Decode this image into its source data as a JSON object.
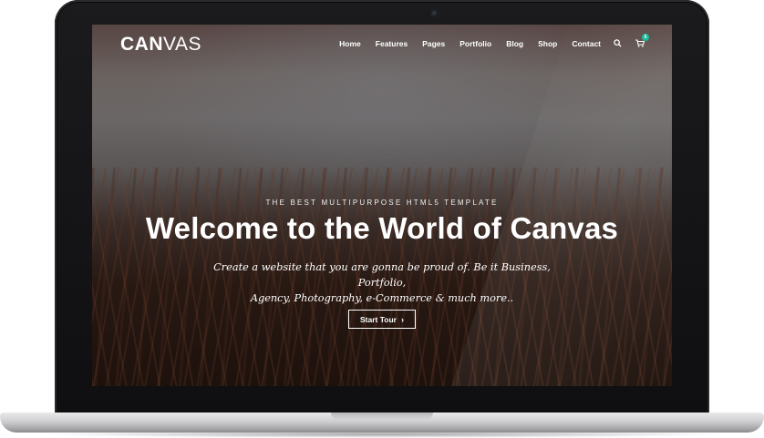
{
  "brand": {
    "logo_bold": "CAN",
    "logo_thin": "VAS"
  },
  "nav": {
    "items": [
      "Home",
      "Features",
      "Pages",
      "Portfolio",
      "Blog",
      "Shop",
      "Contact"
    ],
    "cart_count": "5"
  },
  "hero": {
    "eyebrow": "THE BEST MULTIPURPOSE HTML5 TEMPLATE",
    "title": "Welcome to the World of Canvas",
    "subtitle_line1": "Create a website that you are gonna be proud of. Be it Business, Portfolio,",
    "subtitle_line2": "Agency, Photography, e-Commerce & much more..",
    "cta_label": "Start Tour",
    "cta_chevron": "›"
  },
  "colors": {
    "accent": "#1abc9c",
    "text": "#ffffff"
  },
  "icons": {
    "search": "search-icon",
    "cart": "cart-icon"
  }
}
